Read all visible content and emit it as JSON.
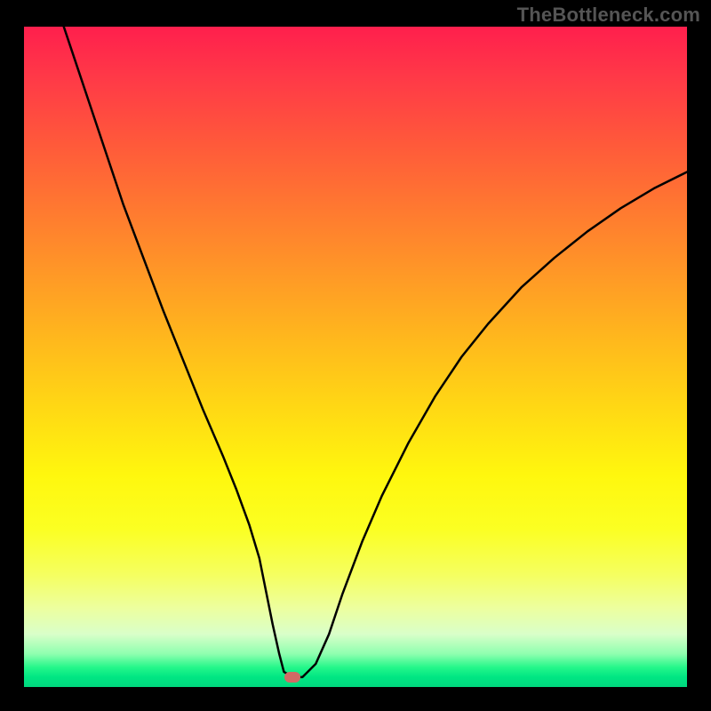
{
  "watermark": "TheBottleneck.com",
  "chart_data": {
    "type": "line",
    "title": "",
    "xlabel": "",
    "ylabel": "",
    "xlim": [
      0,
      100
    ],
    "ylim": [
      0,
      100
    ],
    "grid": false,
    "legend": "none",
    "series": [
      {
        "name": "curve",
        "x": [
          6,
          8,
          10,
          12,
          15,
          18,
          21,
          24,
          27,
          30,
          32,
          34,
          35.5,
          36.5,
          37.5,
          38.5,
          39.2,
          40.5,
          42,
          44,
          46,
          48,
          51,
          54,
          58,
          62,
          66,
          70,
          75,
          80,
          85,
          90,
          95,
          100
        ],
        "y": [
          100,
          94,
          88,
          82,
          73,
          65,
          57,
          49.5,
          42,
          35,
          30,
          24.5,
          19.5,
          14.5,
          9.5,
          5,
          2.3,
          1.5,
          1.5,
          3.5,
          8,
          14,
          22,
          29,
          37,
          44,
          50,
          55,
          60.5,
          65,
          69,
          72.5,
          75.5,
          78
        ]
      }
    ],
    "marker": {
      "x": 40.5,
      "y": 1.5,
      "color": "#d26a65"
    },
    "background_gradient": {
      "direction": "vertical",
      "stops": [
        {
          "pos": 0,
          "color": "#ff1f4d"
        },
        {
          "pos": 0.48,
          "color": "#ffba1c"
        },
        {
          "pos": 0.76,
          "color": "#fbff22"
        },
        {
          "pos": 0.95,
          "color": "#8effaf"
        },
        {
          "pos": 1.0,
          "color": "#00d87e"
        }
      ]
    }
  },
  "colors": {
    "frame": "#000000",
    "curve": "#000000",
    "watermark": "#555555"
  }
}
